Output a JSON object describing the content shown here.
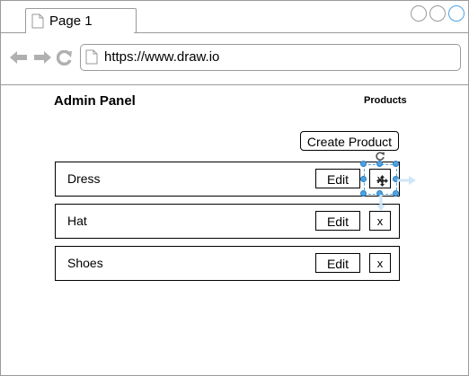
{
  "browser": {
    "tab_title": "Page 1",
    "url": "https://www.draw.io"
  },
  "page": {
    "title": "Admin Panel",
    "nav_link": "Products",
    "create_button": "Create Product"
  },
  "products": [
    {
      "name": "Dress",
      "edit_label": "Edit",
      "delete_label": "x"
    },
    {
      "name": "Hat",
      "edit_label": "Edit",
      "delete_label": "x"
    },
    {
      "name": "Shoes",
      "edit_label": "Edit",
      "delete_label": "x"
    }
  ],
  "colors": {
    "selection": "#4ea3e0",
    "border": "#9a9a9a",
    "icon_gray": "#b0b0b0"
  },
  "icons": [
    "document-icon",
    "back-arrow-icon",
    "forward-arrow-icon",
    "refresh-icon",
    "window-circle-icon",
    "rotate-icon",
    "move-cursor-icon"
  ]
}
